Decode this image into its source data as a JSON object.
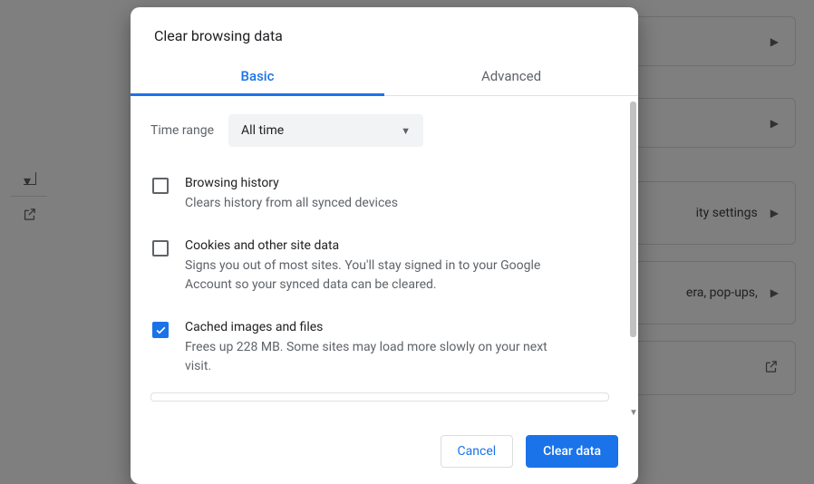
{
  "background": {
    "rows": {
      "security_label": "ity settings",
      "popups_label": "era, pop-ups,"
    }
  },
  "dialog": {
    "title": "Clear browsing data",
    "tabs": {
      "basic": "Basic",
      "advanced": "Advanced"
    },
    "time_range_label": "Time range",
    "time_range_value": "All time",
    "options": [
      {
        "title": "Browsing history",
        "desc": "Clears history from all synced devices",
        "checked": false
      },
      {
        "title": "Cookies and other site data",
        "desc": "Signs you out of most sites. You'll stay signed in to your Google Account so your synced data can be cleared.",
        "checked": false
      },
      {
        "title": "Cached images and files",
        "desc": "Frees up 228 MB. Some sites may load more slowly on your next visit.",
        "checked": true
      }
    ],
    "footer": {
      "cancel": "Cancel",
      "clear": "Clear data"
    }
  }
}
